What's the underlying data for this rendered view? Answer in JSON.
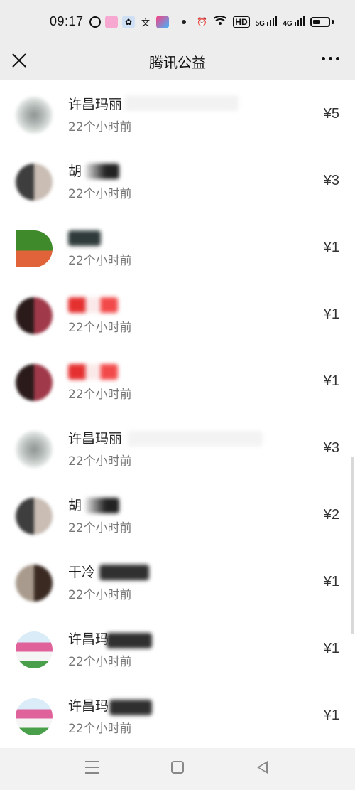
{
  "status_bar": {
    "time": "09:17",
    "app_icons": [
      "chat-app-icon",
      "camera-app-icon",
      "paw-app-icon",
      "text-app-icon",
      "tiktok-app-icon"
    ],
    "right_icons": [
      "alarm-icon",
      "wifi-icon",
      "hd-icon",
      "signal-5g-icon",
      "signal-4g-icon",
      "battery-icon"
    ],
    "hd_label": "HD",
    "net1_label": "5G",
    "net2_label": "4G"
  },
  "header": {
    "title": "腾讯公益"
  },
  "donations": [
    {
      "name": "许昌玛丽",
      "time": "22个小时前",
      "amount": "¥5",
      "avatar_color": "#c9d0cc"
    },
    {
      "name": "胡",
      "time": "22个小时前",
      "amount": "¥3",
      "avatar_color": "#6b5b55"
    },
    {
      "name": "",
      "time": "22个小时前",
      "amount": "¥1",
      "avatar_color": "#3f7a2c"
    },
    {
      "name": "",
      "time": "22个小时前",
      "amount": "¥1",
      "avatar_color": "#5b3a3a"
    },
    {
      "name": "",
      "time": "22个小时前",
      "amount": "¥1",
      "avatar_color": "#5b3a3a"
    },
    {
      "name": "许昌玛丽",
      "time": "22个小时前",
      "amount": "¥3",
      "avatar_color": "#c9d0cc"
    },
    {
      "name": "胡",
      "time": "22个小时前",
      "amount": "¥2",
      "avatar_color": "#6b5b55"
    },
    {
      "name": "干冷",
      "time": "22个小时前",
      "amount": "¥1",
      "avatar_color": "#7a6656"
    },
    {
      "name": "许昌玛",
      "time": "22个小时前",
      "amount": "¥1",
      "avatar_color": "#d86a9b"
    },
    {
      "name": "许昌玛",
      "time": "22个小时前",
      "amount": "¥1",
      "avatar_color": "#d86a9b"
    }
  ]
}
